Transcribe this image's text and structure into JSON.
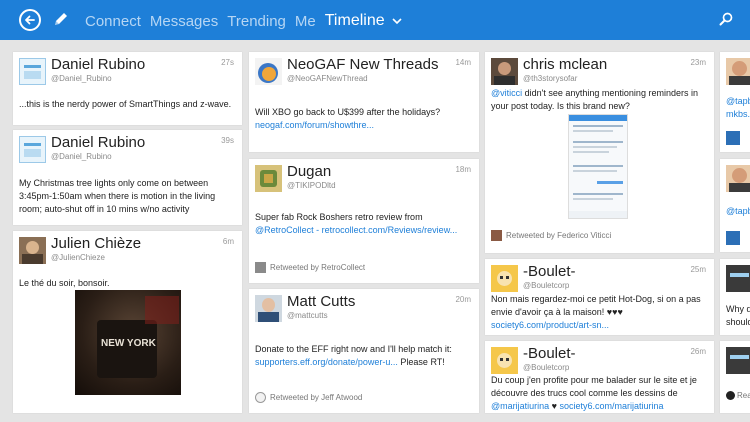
{
  "nav": {
    "items": [
      "Connect",
      "Messages",
      "Trending",
      "Me"
    ],
    "active": "Timeline"
  },
  "col1": [
    {
      "name": "Daniel Rubino",
      "handle": "@Daniel_Rubino",
      "time": "27s",
      "text": "...this is the nerdy power of SmartThings and z-wave."
    },
    {
      "name": "Daniel Rubino",
      "handle": "@Daniel_Rubino",
      "time": "39s",
      "text": "My Christmas tree lights only come on between 3:45pm-1:50am when there is motion in the living room; auto-shut off in 10 mins w/no activity"
    },
    {
      "name": "Julien Chièze",
      "handle": "@JulienChieze",
      "time": "6m",
      "text": "Le thé du soir, bonsoir.",
      "photo_text": "NEW YORK"
    }
  ],
  "col2": [
    {
      "name": "NeoGAF New Threads",
      "handle": "@NeoGAFNewThread",
      "time": "14m",
      "text": "Will XBO go back to U$399 after the holidays?",
      "link": "neogaf.com/forum/showthre..."
    },
    {
      "name": "Dugan",
      "handle": "@TIKIPODltd",
      "time": "18m",
      "text": "Super fab Rock Boshers retro review from",
      "link": "@RetroCollect - retrocollect.com/Reviews/review...",
      "retweet": "Retweeted by RetroCollect"
    },
    {
      "name": "Matt Cutts",
      "handle": "@mattcutts",
      "time": "20m",
      "text": "Donate to the EFF right now and I'll help match it:",
      "link": "supporters.eff.org/donate/power-u...",
      "text2": " Please RT!",
      "retweet": "Retweeted by Jeff Atwood"
    }
  ],
  "col3": [
    {
      "name": "chris mclean",
      "handle": "@th3storysofar",
      "time": "23m",
      "mention": "@viticci",
      "text": " didn't see anything mentioning reminders in your post today. Is this brand new?",
      "retweet": "Retweeted by Federico Viticci"
    },
    {
      "name": "-Boulet-",
      "handle": "@Bouletcorp",
      "time": "25m",
      "text": "Non mais regardez-moi ce petit Hot-Dog, si on a pas envie d'avoir ça à la maison! ♥♥♥",
      "link": "society6.com/product/art-sn..."
    },
    {
      "name": "-Boulet-",
      "handle": "@Bouletcorp",
      "time": "26m",
      "text": "Du coup j'en profite pour me balader sur le site et je découvre des trucs cool comme les dessins de",
      "link": "@marijatiurina",
      "text2": " ♥ ",
      "link2": "society6.com/marijatiurina"
    }
  ],
  "col4": {
    "frag1a": "@tapb",
    "frag1b": "mkbs.n",
    "frag2": "@tapb",
    "frag3a": "Why d",
    "frag3b": "should",
    "frag4": "Rea"
  },
  "colors": {
    "accent": "#1e7fd8",
    "link": "#1e7fd8"
  },
  "icons": [
    "back-arrow-icon",
    "compose-pencil-icon",
    "chevron-down-icon",
    "search-icon"
  ]
}
